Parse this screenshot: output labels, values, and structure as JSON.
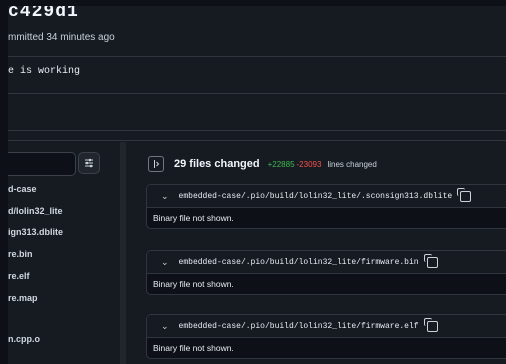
{
  "commit": {
    "hash": "c429d1",
    "committed_text": "mmitted 34 minutes ago",
    "message": "e is working"
  },
  "sidebar": {
    "search_value": "",
    "items": [
      {
        "label": "d-case"
      },
      {
        "label": "d/lolin32_lite"
      },
      {
        "label": "ign313.dblite"
      },
      {
        "label": "re.bin"
      },
      {
        "label": "re.elf"
      },
      {
        "label": "re.map"
      },
      {
        "label": "n.cpp.o"
      }
    ]
  },
  "diff": {
    "files_changed": "29 files changed",
    "additions": "+22885",
    "deletions": "-23093",
    "lines_label": "lines changed",
    "files": [
      {
        "path": "embedded-case/.pio/build/lolin32_lite/.sconsign313.dblite",
        "body": "Binary file not shown."
      },
      {
        "path": "embedded-case/.pio/build/lolin32_lite/firmware.bin",
        "body": "Binary file not shown."
      },
      {
        "path": "embedded-case/.pio/build/lolin32_lite/firmware.elf",
        "body": "Binary file not shown."
      }
    ]
  },
  "icons": {
    "filter": "sliders-icon",
    "toggle": "sidebar-toggle-icon",
    "chevron": "chevron-down-icon",
    "copy": "copy-icon"
  },
  "colors": {
    "additions": "#3fb950",
    "deletions": "#f85149",
    "background": "#161b22"
  }
}
